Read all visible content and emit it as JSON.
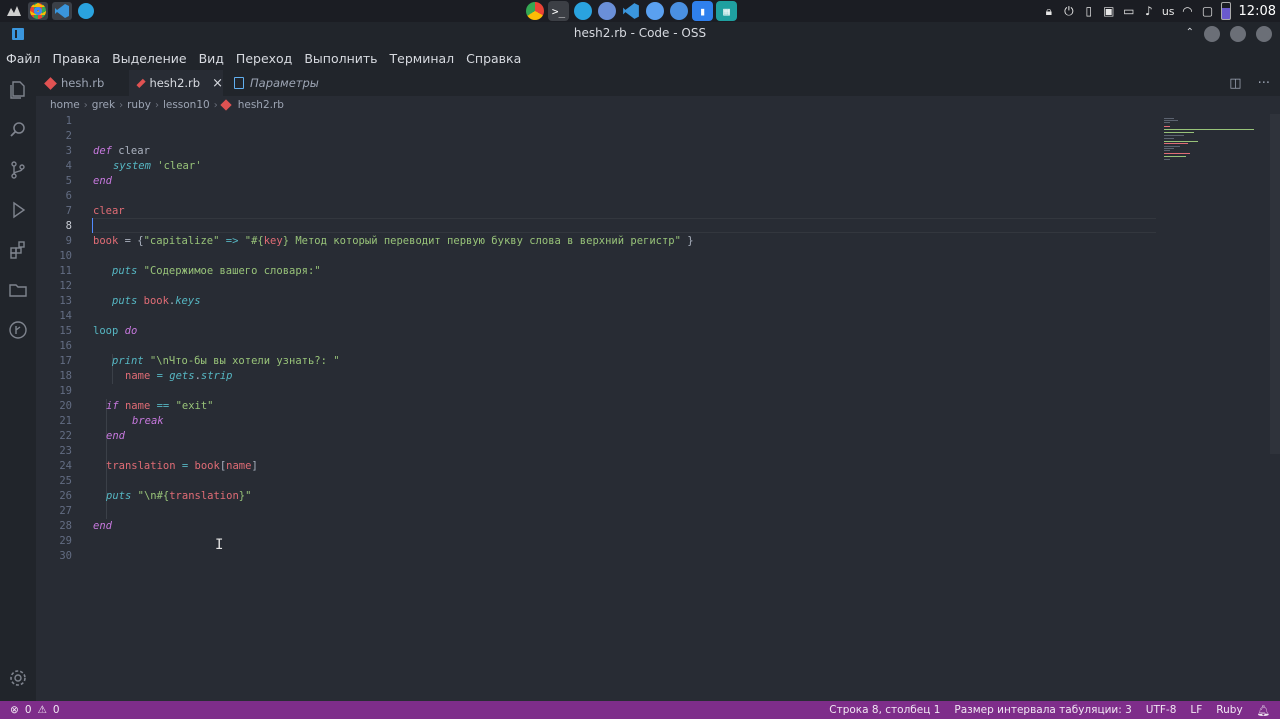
{
  "os_panel": {
    "keyboard_layout": "us",
    "clock": "12:08"
  },
  "window": {
    "title": "hesh2.rb - Code - OSS"
  },
  "menu": [
    "Файл",
    "Правка",
    "Выделение",
    "Вид",
    "Переход",
    "Выполнить",
    "Терминал",
    "Справка"
  ],
  "tabs": [
    {
      "label": "hesh.rb",
      "icon": "ruby-icon",
      "active": false
    },
    {
      "label": "hesh2.rb",
      "icon": "ruby-icon",
      "active": true,
      "close": "×"
    },
    {
      "label": "Параметры",
      "icon": "file-icon",
      "active": false
    }
  ],
  "breadcrumb": {
    "parts": [
      "home",
      "grek",
      "ruby",
      "lesson10"
    ],
    "file": "hesh2.rb"
  },
  "editor": {
    "line_numbers": [
      "1",
      "2",
      "3",
      "4",
      "5",
      "6",
      "7",
      "8",
      "9",
      "10",
      "11",
      "12",
      "13",
      "14",
      "15",
      "16",
      "17",
      "18",
      "19",
      "20",
      "21",
      "22",
      "23",
      "24",
      "25",
      "26",
      "27",
      "28",
      "29",
      "30"
    ],
    "tokens": {
      "l3_def": "def",
      "l3_name": " clear",
      "l4_system": "system",
      "l4_str": " 'clear'",
      "l5_end": "end",
      "l7_clear": "clear",
      "l9_book": "book",
      "l9_eq": " = {",
      "l9_key": "\"capitalize\"",
      "l9_arrow": " => ",
      "l9_str1": "\"#{",
      "l9_interp": "key",
      "l9_str2": "} Метод который переводит первую букву слова в верхний регистр\"",
      "l9_close": " }",
      "l11_puts": "puts",
      "l11_str": " \"Содержимое вашего словаря:\"",
      "l13_puts": "puts",
      "l13_book": " book",
      "l13_dot": ".",
      "l13_keys": "keys",
      "l15_loop": "loop",
      "l15_do": " do",
      "l17_print": "print",
      "l17_str": " \"\\nЧто-бы вы хотели узнать?: \"",
      "l18_name": "name",
      "l18_eq": " = ",
      "l18_gets": "gets",
      "l18_dot": ".",
      "l18_strip": "strip",
      "l20_if": "if",
      "l20_name": " name",
      "l20_eq": " == ",
      "l20_str": "\"exit\"",
      "l21_break": "break",
      "l22_end": "end",
      "l24_tr": "translation",
      "l24_eq": " = ",
      "l24_book": "book",
      "l24_br1": "[",
      "l24_name": "name",
      "l24_br2": "]",
      "l26_puts": "puts",
      "l26_str1": " \"\\n#{",
      "l26_interp": "translation",
      "l26_str2": "}\"",
      "l28_end": "end"
    }
  },
  "statusbar": {
    "errors": "0",
    "warnings": "0",
    "position": "Строка 8, столбец 1",
    "indent": "Размер интервала табуляции: 3",
    "encoding": "UTF-8",
    "eol": "LF",
    "language": "Ruby"
  }
}
